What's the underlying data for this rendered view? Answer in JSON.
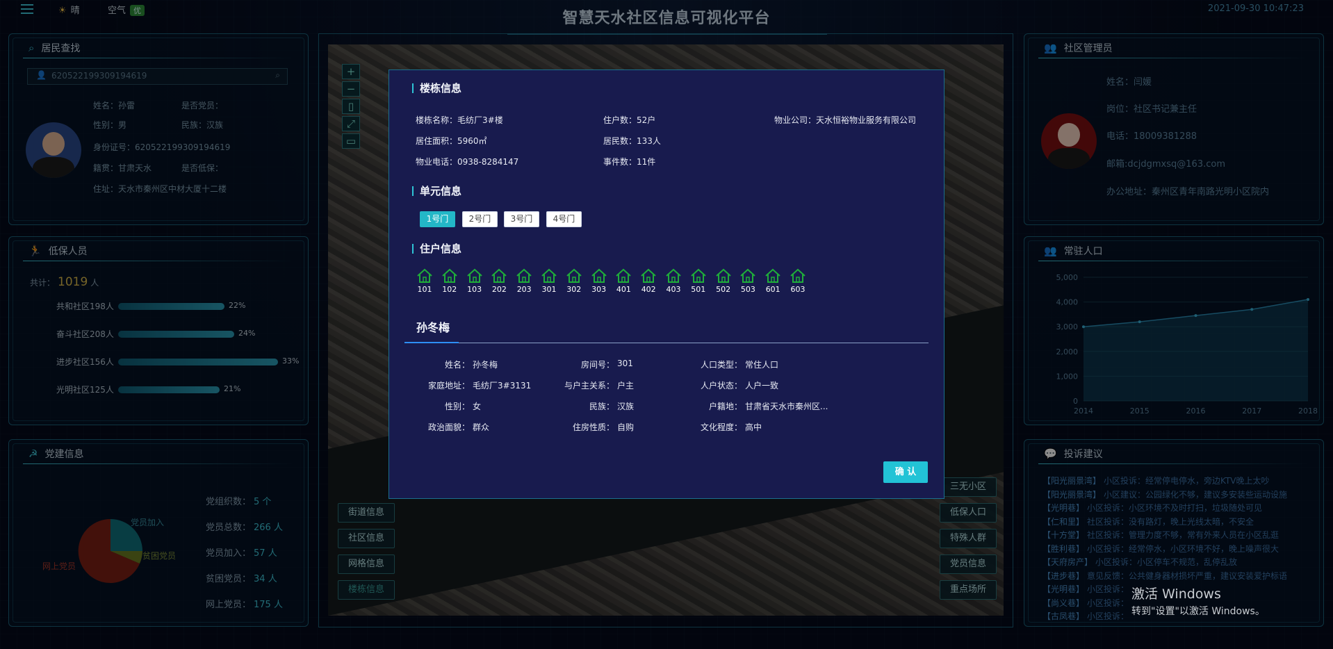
{
  "header": {
    "title": "智慧天水社区信息可视化平台",
    "weather": "晴",
    "air_label": "空气",
    "air_quality": "优",
    "datetime": "2021-09-30 10:47:23"
  },
  "resident_search": {
    "title": "居民查找",
    "search_value": "620522199309194619",
    "name": "姓名：孙雷",
    "party_member": "是否党员：",
    "gender": "性别：男",
    "ethnicity": "民族：汉族",
    "id_number": "身份证号：620522199309194619",
    "native": "籍贯：甘肃天水",
    "low_income": "是否低保：",
    "address": "住址：天水市秦州区中材大厦十二楼"
  },
  "low_income": {
    "title": "低保人员",
    "total_label": "共计：",
    "total_value": "1019",
    "total_unit": "人",
    "rows": [
      {
        "label": "共和社区198人",
        "pct": "22%",
        "value": 22
      },
      {
        "label": "奋斗社区208人",
        "pct": "24%",
        "value": 24
      },
      {
        "label": "进步社区156人",
        "pct": "33%",
        "value": 33
      },
      {
        "label": "光明社区125人",
        "pct": "21%",
        "value": 21
      }
    ]
  },
  "party": {
    "title": "党建信息",
    "pie_labels": {
      "join": "党员加入",
      "poor": "贫困党员",
      "online": "网上党员"
    },
    "stats": [
      {
        "label": "党组织数：",
        "value": "5 个"
      },
      {
        "label": "党员总数：",
        "value": "266 人"
      },
      {
        "label": "党员加入：",
        "value": "57 人"
      },
      {
        "label": "贫困党员：",
        "value": "34 人"
      },
      {
        "label": "网上党员：",
        "value": "175 人"
      }
    ]
  },
  "map": {
    "zoom_in": "+",
    "zoom_out": "−",
    "left_buttons": [
      "街道信息",
      "社区信息",
      "网格信息",
      "楼栋信息"
    ],
    "right_buttons": [
      "三无小区",
      "低保人口",
      "特殊人群",
      "党员信息",
      "重点场所"
    ]
  },
  "manager": {
    "title": "社区管理员",
    "name": "姓名：闫媛",
    "position": "岗位：社区书记兼主任",
    "phone": "电话：18009381288",
    "email": "邮箱:dcjdgmxsq@163.com",
    "office": "办公地址：秦州区青年南路光明小区院内"
  },
  "population": {
    "title": "常驻人口",
    "y_ticks": [
      "5,000",
      "4,000",
      "3,000",
      "2,000",
      "1,000",
      "0"
    ],
    "x_ticks": [
      "2014",
      "2015",
      "2016",
      "2017",
      "2018"
    ]
  },
  "chart_data": {
    "type": "area",
    "title": "常驻人口",
    "x": [
      "2014",
      "2015",
      "2016",
      "2017",
      "2018"
    ],
    "values": [
      3000,
      3200,
      3450,
      3700,
      4100
    ],
    "ylim": [
      0,
      5000
    ]
  },
  "complaints": {
    "title": "投诉建议",
    "items": [
      {
        "tag": "【阳光丽景湾】",
        "text": "小区投诉：经常停电停水，旁边KTV晚上太吵"
      },
      {
        "tag": "【阳光丽景湾】",
        "text": "小区建议：公园绿化不够，建议多安装些运动设施"
      },
      {
        "tag": "【光明巷】",
        "text": "小区投诉：小区环境不及时打扫，垃圾随处可见"
      },
      {
        "tag": "【仁和里】",
        "text": "社区投诉：没有路灯，晚上光线太暗，不安全"
      },
      {
        "tag": "【十方堂】",
        "text": "社区投诉：管理力度不够，常有外来人员在小区乱逛"
      },
      {
        "tag": "【胜利巷】",
        "text": "小区投诉：经常停水，小区环境不好，晚上噪声很大"
      },
      {
        "tag": "【天府房产】",
        "text": "小区投诉：小区停车不规范，乱停乱放"
      },
      {
        "tag": "【进步巷】",
        "text": "意见反馈：公共健身器材损坏严重，建议安装爱护标语"
      },
      {
        "tag": "【光明巷】",
        "text": "小区投诉："
      },
      {
        "tag": "【尚义巷】",
        "text": "小区投诉："
      },
      {
        "tag": "【古凤巷】",
        "text": "小区投诉："
      }
    ]
  },
  "windows_watermark": {
    "line1": "激活 Windows",
    "line2": "转到\"设置\"以激活 Windows。"
  },
  "modal": {
    "building_section": "楼栋信息",
    "building_fields": [
      "楼栋名称：毛纺厂3#楼",
      "住户数：52户",
      "物业公司：天水恒裕物业服务有限公司",
      "居住面积：5960㎡",
      "居民数：133人",
      "物业电话：0938-8284147",
      "事件数：11件"
    ],
    "unit_section": "单元信息",
    "units": [
      "1号门",
      "2号门",
      "3号门",
      "4号门"
    ],
    "household_section": "住户信息",
    "rooms": [
      "101",
      "102",
      "103",
      "202",
      "203",
      "301",
      "302",
      "303",
      "401",
      "402",
      "403",
      "501",
      "502",
      "503",
      "601",
      "603"
    ],
    "person_name": "孙冬梅",
    "person_fields": [
      {
        "label": "姓名：",
        "value": "孙冬梅"
      },
      {
        "label": "房间号：",
        "value": "301"
      },
      {
        "label": "人口类型：",
        "value": "常住人口"
      },
      {
        "label": "家庭地址：",
        "value": "毛纺厂3#3131"
      },
      {
        "label": "与户主关系：",
        "value": "户主"
      },
      {
        "label": "人户状态：",
        "value": "人户一致"
      },
      {
        "label": "性别：",
        "value": "女"
      },
      {
        "label": "民族：",
        "value": "汉族"
      },
      {
        "label": "户籍地：",
        "value": "甘肃省天水市秦州区..."
      },
      {
        "label": "政治面貌：",
        "value": "群众"
      },
      {
        "label": "住房性质：",
        "value": "自购"
      },
      {
        "label": "文化程度：",
        "value": "高中"
      }
    ],
    "confirm": "确 认"
  }
}
